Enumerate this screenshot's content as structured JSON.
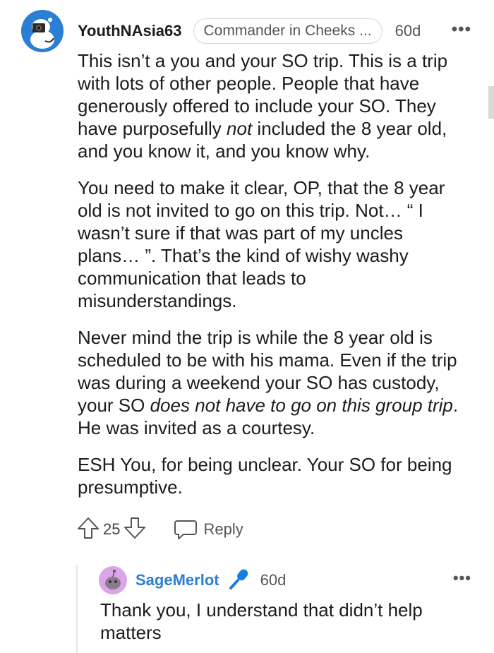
{
  "comment": {
    "username": "YouthNAsia63",
    "flair": "Commander in Cheeks ...",
    "age": "60d",
    "paragraphs": [
      [
        {
          "t": "This isn’t a you and your SO trip. This is a trip with lots of other people. People that have generously offered to include your SO. They have purposefully "
        },
        {
          "t": "not",
          "em": true
        },
        {
          "t": " included the 8 year old, and you know it, and you know why."
        }
      ],
      [
        {
          "t": "You need to make it clear, OP, that the 8 year old is not invited to go on this trip. Not… “ I wasn’t sure if that was part of my uncles plans… ”. That’s the kind of wishy washy communication that leads to misunderstandings."
        }
      ],
      [
        {
          "t": "Never mind the trip is while the 8 year old is scheduled to be with his mama. Even if the trip was during a weekend your SO has custody, your SO "
        },
        {
          "t": "does not have to go on this group trip",
          "em": true
        },
        {
          "t": ". He was invited as a courtesy."
        }
      ],
      [
        {
          "t": "ESH You, for being unclear. Your SO for being presumptive."
        }
      ]
    ],
    "votes": "25",
    "reply_label": "Reply",
    "more_label": "•••"
  },
  "reply": {
    "username": "SageMerlot",
    "age": "60d",
    "text": "Thank you, I understand that didn’t help matters",
    "more_label": "•••"
  },
  "icons": {
    "upvote": "upvote-icon",
    "downvote": "downvote-icon",
    "reply": "reply-bubble-icon",
    "microphone": "microphone-icon",
    "overflow": "overflow-menu-icon"
  },
  "colors": {
    "accent_username": "#2d7fd0",
    "mic": "#1a7de0",
    "avatar_main": "#2a7fd4",
    "avatar_reply": "#d9a6e8"
  }
}
